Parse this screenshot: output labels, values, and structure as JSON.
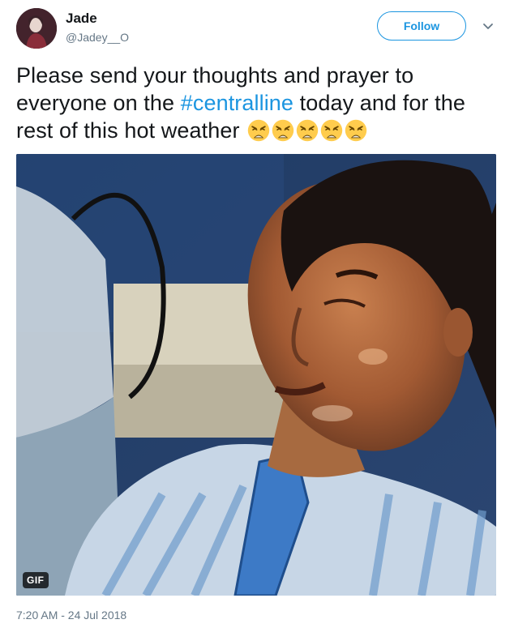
{
  "user": {
    "display_name": "Jade",
    "handle": "@Jadey__O",
    "avatar_icon": "profile-photo"
  },
  "actions": {
    "follow_label": "Follow",
    "caret_icon": "chevron-down-icon"
  },
  "tweet": {
    "text_before": "Please send your thoughts and prayer to everyone on the ",
    "hashtag": "#centralline",
    "text_after": " today and for the rest of this hot weather ",
    "emoji_icon": "weary-face-emoji",
    "emoji_count": 5
  },
  "media": {
    "badge": "GIF",
    "subject": "man-sweating-gif"
  },
  "meta": {
    "timestamp": "7:20 AM - 24 Jul 2018"
  },
  "colors": {
    "accent": "#1b95e0",
    "text": "#14171a",
    "muted": "#657786"
  }
}
